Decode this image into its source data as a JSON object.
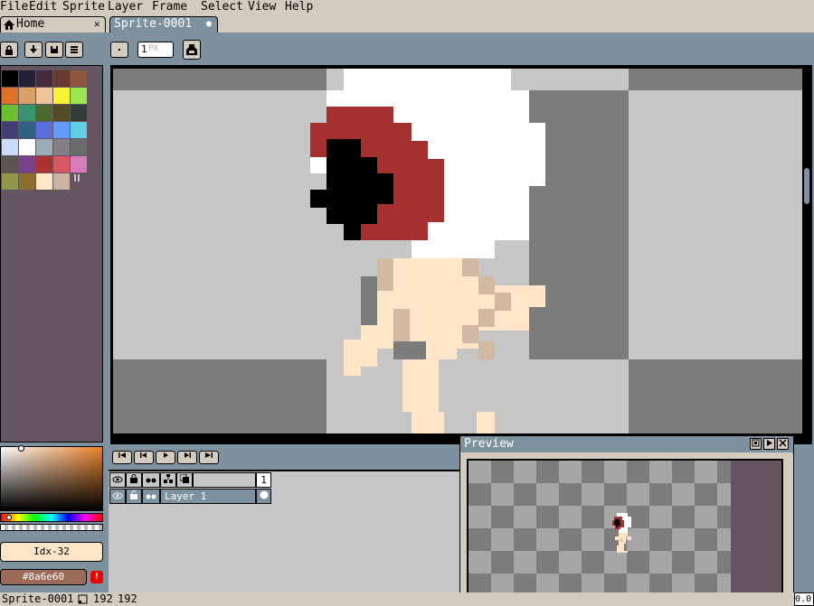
{
  "menu": {
    "items": [
      {
        "label": "File"
      },
      {
        "label": "Edit"
      },
      {
        "label": "Sprite"
      },
      {
        "label": "Layer"
      },
      {
        "label": "Frame"
      },
      {
        "label": "Select"
      },
      {
        "label": "View"
      },
      {
        "label": "Help"
      }
    ]
  },
  "tabs": {
    "home_label": "Home",
    "sprite_label": "Sprite-0001",
    "close_glyph": "✕",
    "modified_glyph": "●"
  },
  "toolbar": {
    "brush_size_value": "1",
    "brush_size_unit": "PX"
  },
  "palette": {
    "colors": [
      "#000000",
      "#222034",
      "#45283c",
      "#663931",
      "#8f563b",
      "#df7126",
      "#d9a066",
      "#eec39a",
      "#fbf236",
      "#99e550",
      "#6abe30",
      "#37946e",
      "#4b692f",
      "#524b24",
      "#323c39",
      "#3f3f74",
      "#306082",
      "#5b6ee1",
      "#639bff",
      "#5fcde4",
      "#cbdbfc",
      "#ffffff",
      "#9badb7",
      "#847e87",
      "#696a6a",
      "#595652",
      "#76428a",
      "#ac3232",
      "#d95763",
      "#d77bba",
      "#8f974a",
      "#8a6f30",
      "#ffe6c9",
      "#c8b4a0"
    ]
  },
  "color": {
    "index_label": "Idx-32",
    "hex_value": "#8a6e60",
    "warning_glyph": "!"
  },
  "timeline": {
    "frame_number": "1",
    "layer_name": "Layer 1"
  },
  "preview": {
    "title": "Preview"
  },
  "status": {
    "sprite_name": "Sprite-0001",
    "size_w": "192",
    "size_h": "192",
    "zoom_text": "0.0"
  },
  "colors": {
    "skin": "#ffe6c9",
    "skin_shade": "#d2b9a1",
    "red": "#a53030",
    "white": "#ffffff",
    "black": "#000000",
    "panel_blue": "#7d929e",
    "panel_purple": "#655561",
    "bg_beige": "#d3cbbd"
  }
}
